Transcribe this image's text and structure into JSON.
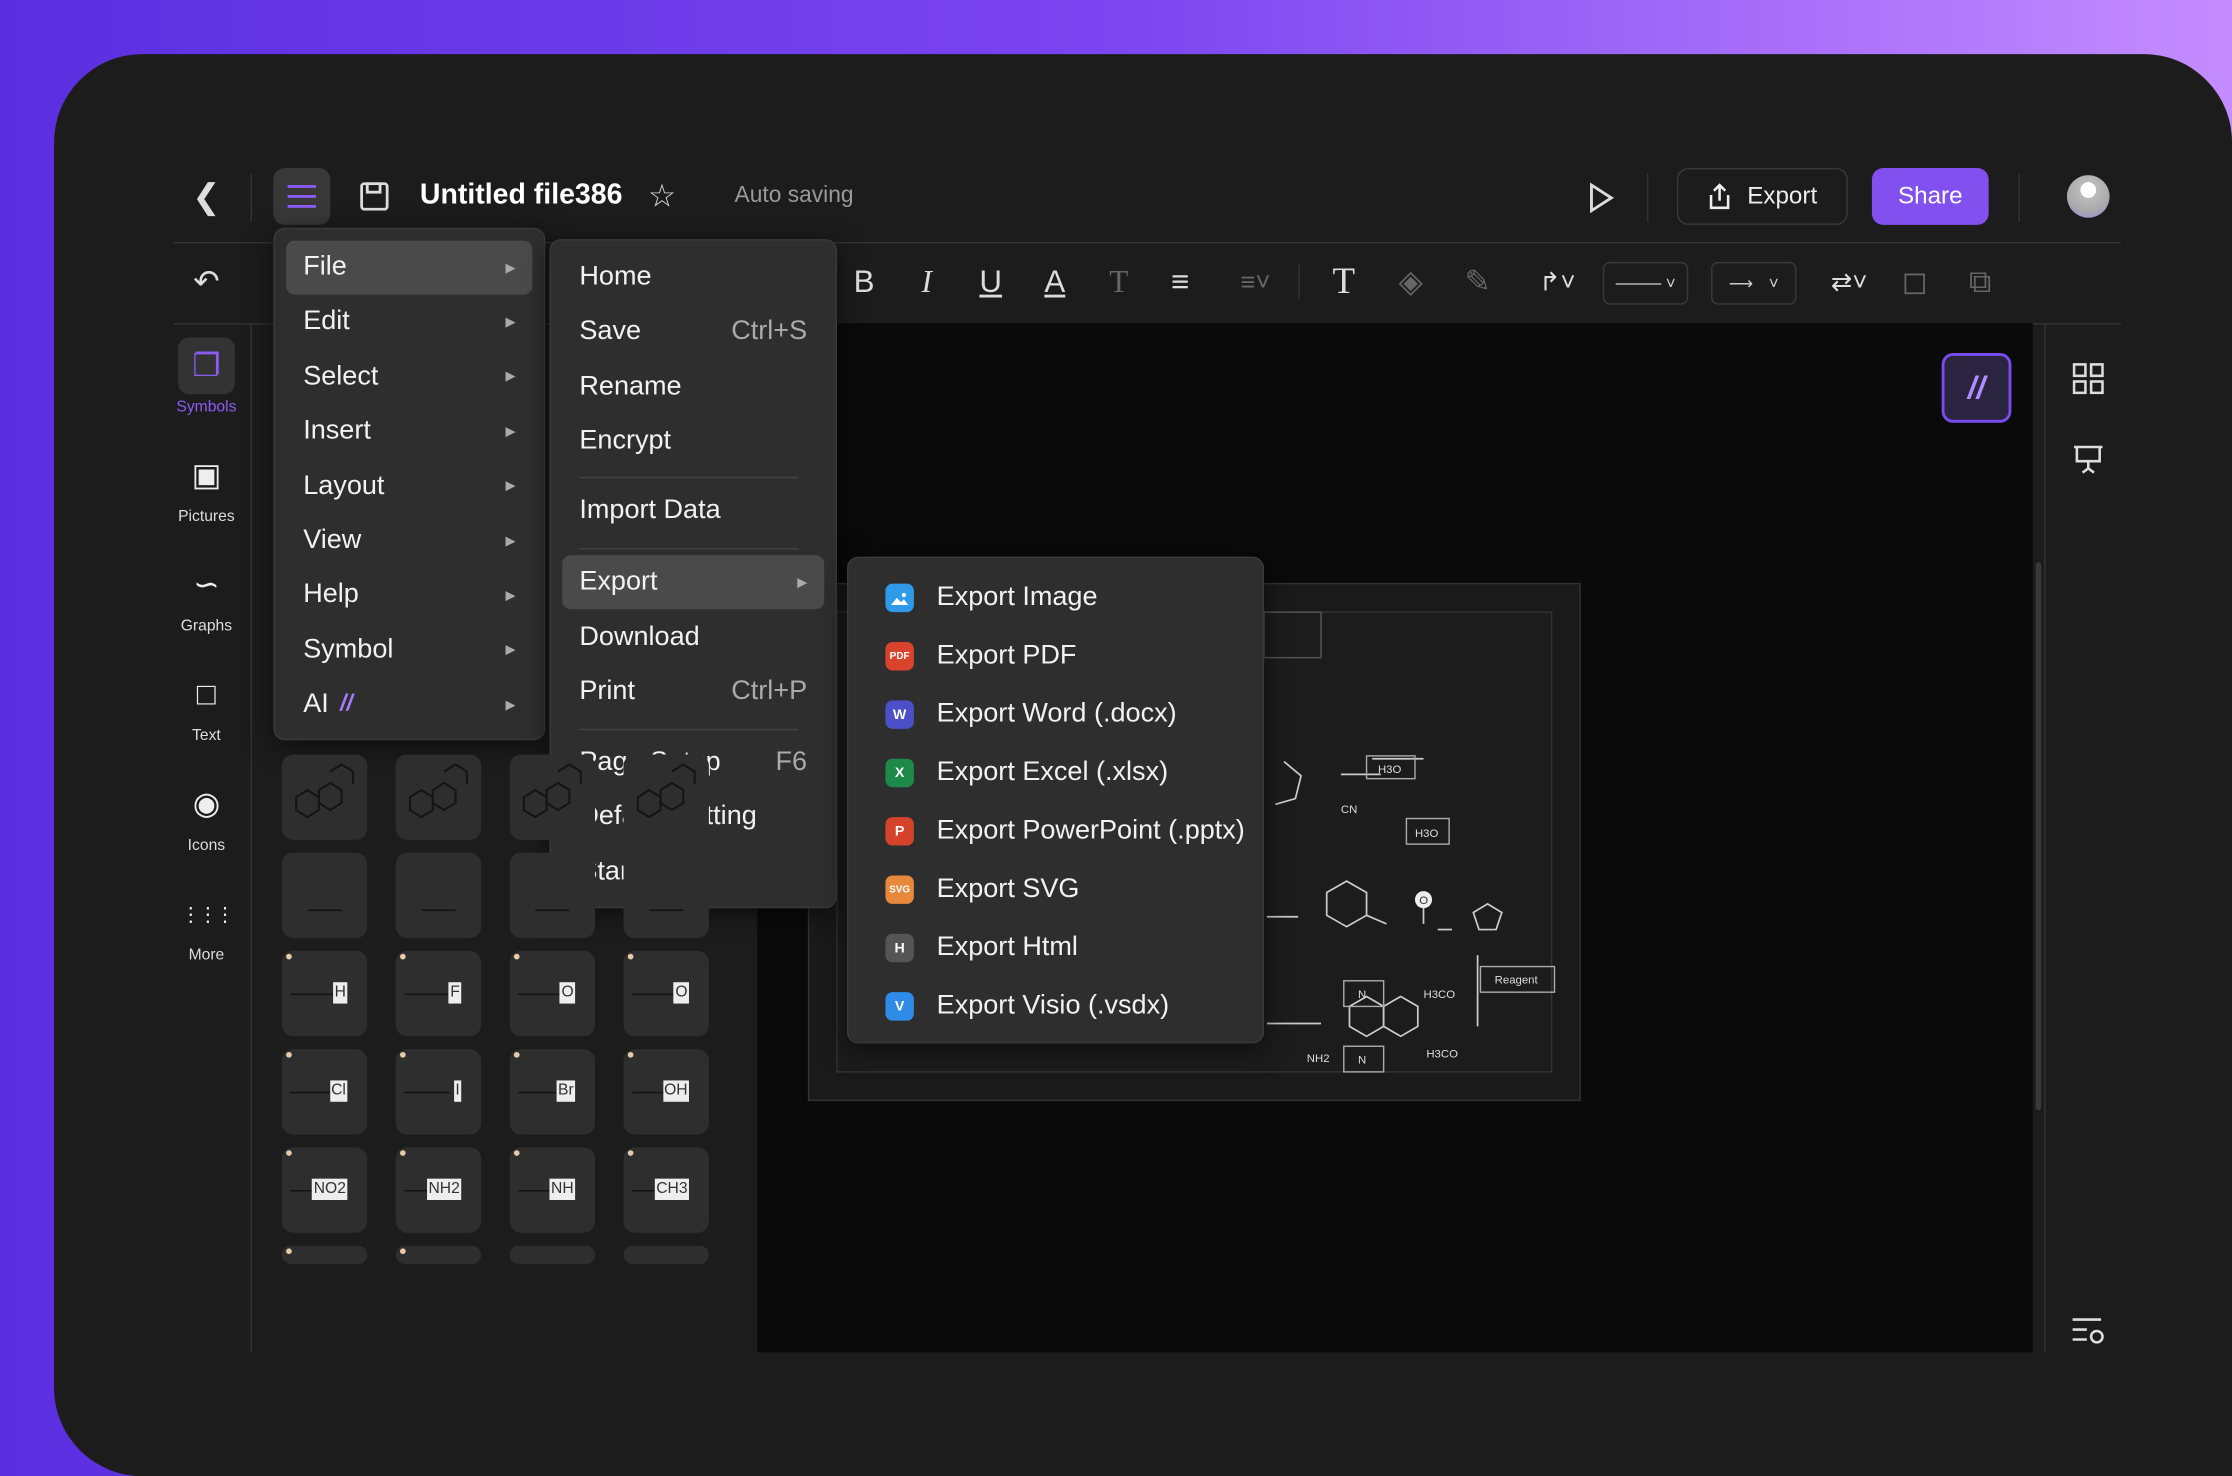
{
  "header": {
    "title": "Untitled file386",
    "status": "Auto saving",
    "export_label": "Export",
    "share_label": "Share"
  },
  "colors": {
    "accent": "#8150ee",
    "menu_bg": "#2e2e2e",
    "canvas_bg": "#0a0a0a"
  },
  "sidebar": {
    "items": [
      {
        "label": "Symbols",
        "icon": "symbols-icon",
        "active": true
      },
      {
        "label": "Pictures",
        "icon": "picture-icon"
      },
      {
        "label": "Graphs",
        "icon": "graph-icon"
      },
      {
        "label": "Text",
        "icon": "text-icon"
      },
      {
        "label": "Icons",
        "icon": "icons-icon"
      },
      {
        "label": "More",
        "icon": "grid-dots-icon"
      }
    ]
  },
  "symbols": {
    "tiles": [
      "H",
      "F",
      "O",
      "O",
      "Cl",
      "I",
      "Br",
      "OH",
      "NO2",
      "NH2",
      "NH",
      "CH3"
    ]
  },
  "main_menu": {
    "items": [
      {
        "label": "File"
      },
      {
        "label": "Edit"
      },
      {
        "label": "Select"
      },
      {
        "label": "Insert"
      },
      {
        "label": "Layout"
      },
      {
        "label": "View"
      },
      {
        "label": "Help"
      },
      {
        "label": "Symbol"
      },
      {
        "label": "AI"
      }
    ]
  },
  "file_menu": {
    "items": [
      {
        "label": "Home",
        "shortcut": ""
      },
      {
        "label": "Save",
        "shortcut": "Ctrl+S"
      },
      {
        "label": "Rename",
        "shortcut": ""
      },
      {
        "label": "Encrypt",
        "shortcut": ""
      },
      {
        "label": "Import Data",
        "shortcut": ""
      },
      {
        "label": "Export",
        "shortcut": ""
      },
      {
        "label": "Download",
        "shortcut": ""
      },
      {
        "label": "Print",
        "shortcut": "Ctrl+P"
      },
      {
        "label": "Page Setup",
        "shortcut": "F6"
      },
      {
        "label": "Default Setting",
        "shortcut": ""
      },
      {
        "label": "Star",
        "shortcut": ""
      }
    ]
  },
  "export_menu": {
    "items": [
      {
        "label": "Export Image",
        "badge": "",
        "color": "#2f9be8"
      },
      {
        "label": "Export PDF",
        "badge": "PDF",
        "color": "#d9432c"
      },
      {
        "label": "Export Word (.docx)",
        "badge": "W",
        "color": "#4b50c8"
      },
      {
        "label": "Export Excel (.xlsx)",
        "badge": "X",
        "color": "#1d8a4a"
      },
      {
        "label": "Export PowerPoint (.pptx)",
        "badge": "P",
        "color": "#d4432a"
      },
      {
        "label": "Export SVG",
        "badge": "SVG",
        "color": "#e8883a"
      },
      {
        "label": "Export Html",
        "badge": "H",
        "color": "#555555"
      },
      {
        "label": "Export Visio (.vsdx)",
        "badge": "V",
        "color": "#2f8be8"
      }
    ]
  },
  "diagram": {
    "labels": [
      "H3O",
      "H3O",
      "Reagent",
      "N",
      "N",
      "NH2",
      "H3CO",
      "H3CO",
      "CN",
      "O"
    ]
  }
}
